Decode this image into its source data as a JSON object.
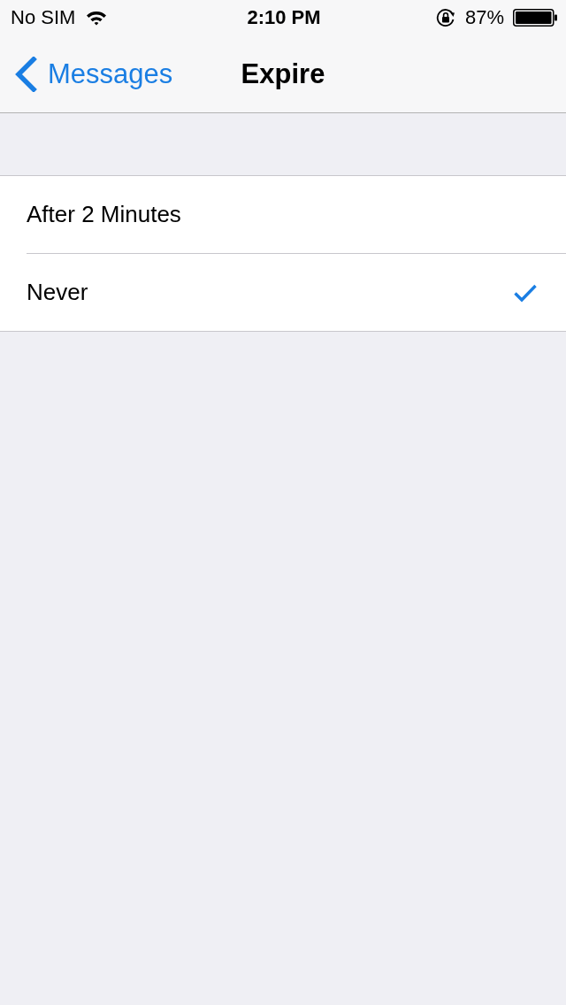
{
  "status_bar": {
    "carrier": "No SIM",
    "time": "2:10 PM",
    "battery_percent": "87%"
  },
  "nav_bar": {
    "back_label": "Messages",
    "title": "Expire"
  },
  "options": [
    {
      "label": "After 2 Minutes",
      "selected": false
    },
    {
      "label": "Never",
      "selected": true
    }
  ]
}
